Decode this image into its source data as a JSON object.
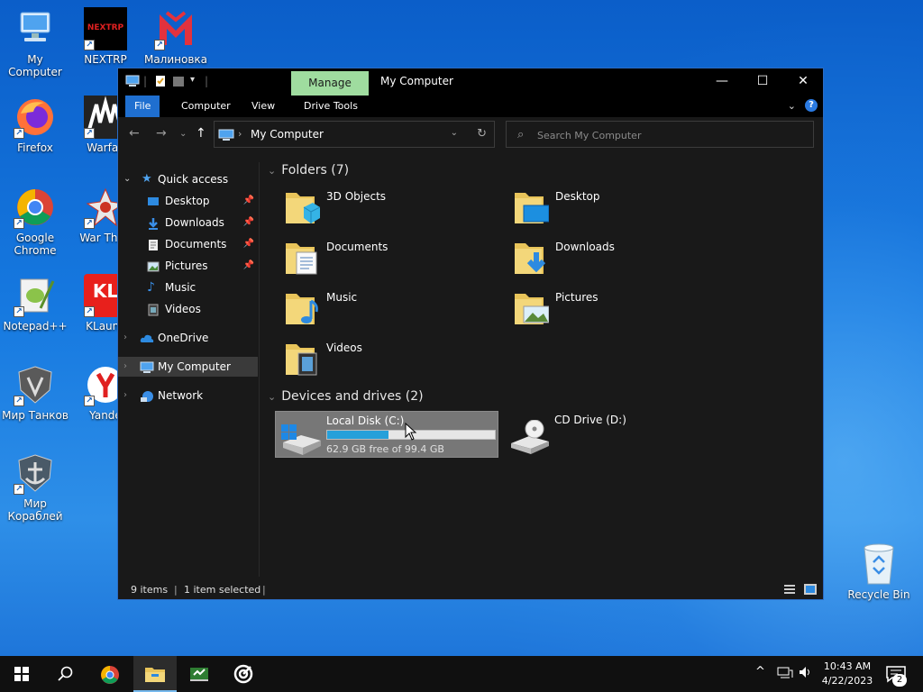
{
  "desktop": {
    "icons": [
      {
        "label": "My Computer"
      },
      {
        "label": "NEXTRP"
      },
      {
        "label": "Малиновка"
      },
      {
        "label": "Firefox"
      },
      {
        "label": "Warfac"
      },
      {
        "label": "Google Chrome"
      },
      {
        "label": "War Thun"
      },
      {
        "label": "Notepad++"
      },
      {
        "label": "KLaunc"
      },
      {
        "label": "Мир Танков"
      },
      {
        "label": "Yande"
      },
      {
        "label": "Мир Кораблей"
      }
    ],
    "nextrp_logo_text": "NEXTRP",
    "klauncher_logo_text": "KL",
    "recycle_bin": {
      "label": "Recycle Bin"
    }
  },
  "window": {
    "title": "My Computer",
    "manage_tab": "Manage",
    "controls": {
      "minimize": "—",
      "maximize": "☐",
      "close": "✕"
    },
    "ribbon_tabs": [
      "File",
      "Computer",
      "View",
      "Drive Tools"
    ],
    "address": {
      "location": "My Computer"
    },
    "search": {
      "placeholder": "Search My Computer"
    },
    "sidebar": {
      "quick_access": "Quick access",
      "items": [
        {
          "label": "Desktop",
          "pinned": true
        },
        {
          "label": "Downloads",
          "pinned": true
        },
        {
          "label": "Documents",
          "pinned": true
        },
        {
          "label": "Pictures",
          "pinned": true
        },
        {
          "label": "Music",
          "pinned": false
        },
        {
          "label": "Videos",
          "pinned": false
        }
      ],
      "onedrive": "OneDrive",
      "my_computer": "My Computer",
      "network": "Network"
    },
    "folders_header": "Folders (7)",
    "folders": [
      "3D Objects",
      "Desktop",
      "Documents",
      "Downloads",
      "Music",
      "Pictures",
      "Videos"
    ],
    "devices_header": "Devices and drives (2)",
    "drives": [
      {
        "name": "Local Disk (C:)",
        "free_text": "62.9 GB free of 99.4 GB",
        "used_fraction": 0.367
      },
      {
        "name": "CD Drive (D:)"
      }
    ],
    "status": {
      "items": "9 items",
      "selected": "1 item selected"
    }
  },
  "taskbar": {
    "clock_time": "10:43 AM",
    "clock_date": "4/22/2023",
    "notification_count": "2"
  },
  "colors": {
    "accent": "#1f6fd0",
    "manage_tab": "#9fdc9f",
    "drive_bar": "#26a0da",
    "window_bg": "#191919"
  }
}
